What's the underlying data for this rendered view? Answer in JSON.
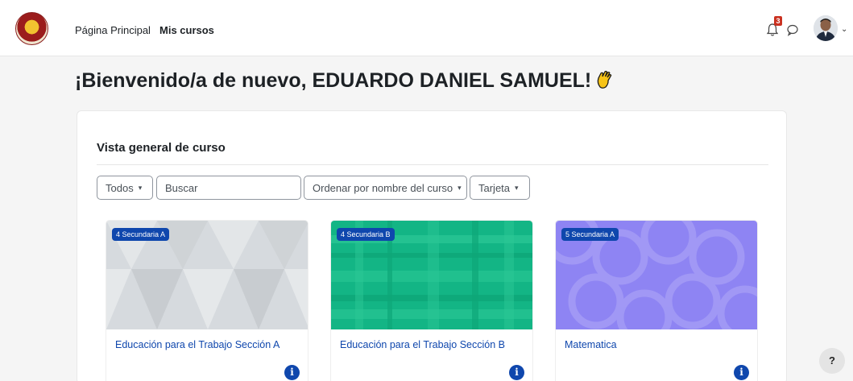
{
  "nav": {
    "home_label": "Página Principal",
    "courses_label": "Mis cursos",
    "notification_count": "3",
    "logo_icon": "school-crest-icon",
    "bell_icon": "bell-icon",
    "chat_icon": "chat-bubble-icon",
    "avatar_icon": "user-avatar"
  },
  "welcome": {
    "text": "¡Bienvenido/a de nuevo, EDUARDO DANIEL SAMUEL!",
    "emoji_icon": "waving-hand-icon"
  },
  "overview": {
    "title": "Vista general de curso",
    "filter_label": "Todos",
    "search_placeholder": "Buscar",
    "sort_label": "Ordenar por nombre del curso",
    "view_label": "Tarjeta"
  },
  "courses": [
    {
      "category": "4 Secundaria A",
      "name": "Educación para el Trabajo Sección A",
      "color": "#d6dade"
    },
    {
      "category": "4 Secundaria B",
      "name": "Educación para el Trabajo Sección B",
      "color": "#13b585"
    },
    {
      "category": "5 Secundaria A",
      "name": "Matematica",
      "color": "#8e84f3"
    }
  ],
  "colors": {
    "accent": "#0f47ad",
    "badge_red": "#ca3120"
  },
  "help_label": "?"
}
